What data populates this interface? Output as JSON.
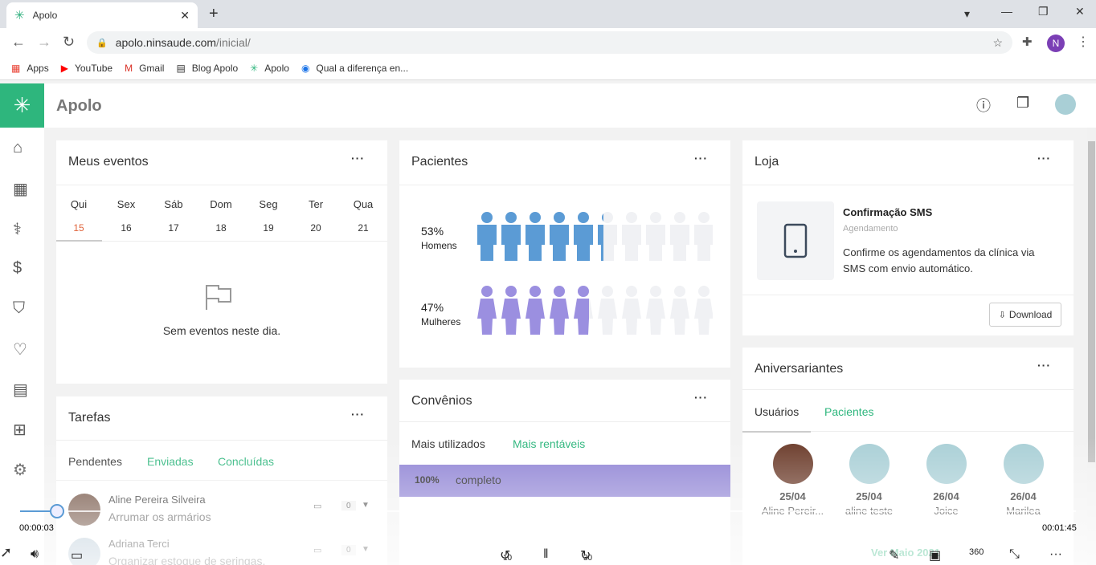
{
  "browser": {
    "tab_title": "Apolo",
    "url_host": "apolo.ninsaude.com",
    "url_path": "/inicial/",
    "profile_initial": "N",
    "bookmarks": [
      {
        "label": "Apps",
        "icon": "apps-grid-icon"
      },
      {
        "label": "YouTube",
        "icon": "youtube-icon"
      },
      {
        "label": "Gmail",
        "icon": "gmail-icon"
      },
      {
        "label": "Blog Apolo",
        "icon": "blog-icon"
      },
      {
        "label": "Apolo",
        "icon": "apolo-icon"
      },
      {
        "label": "Qual a diferença en...",
        "icon": "globe-icon"
      }
    ]
  },
  "app": {
    "title": "Apolo"
  },
  "eventos": {
    "title": "Meus eventos",
    "days": [
      {
        "name": "Qui",
        "num": "15"
      },
      {
        "name": "Sex",
        "num": "16"
      },
      {
        "name": "Sáb",
        "num": "17"
      },
      {
        "name": "Dom",
        "num": "18"
      },
      {
        "name": "Seg",
        "num": "19"
      },
      {
        "name": "Ter",
        "num": "20"
      },
      {
        "name": "Qua",
        "num": "21"
      }
    ],
    "empty_text": "Sem eventos neste dia."
  },
  "tarefas": {
    "title": "Tarefas",
    "tabs": [
      "Pendentes",
      "Enviadas",
      "Concluídas"
    ],
    "items": [
      {
        "name": "Aline Pereira Silveira",
        "task": "Arrumar os armários",
        "comments": "0"
      },
      {
        "name": "Adriana Terci",
        "task": "Organizar estoque de seringas.",
        "comments": "0"
      }
    ]
  },
  "pacientes": {
    "title": "Pacientes",
    "homens_pct": "53%",
    "homens_label": "Homens",
    "homens_value": 0.53,
    "mulheres_pct": "47%",
    "mulheres_label": "Mulheres",
    "mulheres_value": 0.47,
    "male_color": "#5b9bd5",
    "female_color": "#9b8fe0"
  },
  "convenios": {
    "title": "Convênios",
    "tabs": [
      "Mais utilizados",
      "Mais rentáveis"
    ],
    "bar_pct": "100%",
    "bar_label": "completo",
    "bar_color": "#8e82d4"
  },
  "loja": {
    "title": "Loja",
    "product_name": "Confirmação SMS",
    "product_category": "Agendamento",
    "product_desc": "Confirme os agendamentos da clínica via SMS com envio automático.",
    "download_label": "Download"
  },
  "aniversariantes": {
    "title": "Aniversariantes",
    "tabs": [
      "Usuários",
      "Pacientes"
    ],
    "people": [
      {
        "date": "25/04",
        "name": "Aline Pereir..."
      },
      {
        "date": "25/04",
        "name": "aline teste"
      },
      {
        "date": "26/04",
        "name": "Joice"
      },
      {
        "date": "26/04",
        "name": "Marilea"
      }
    ],
    "footer_link": "Ver Maio 2021"
  },
  "video": {
    "time_current": "00:00:03",
    "time_total": "00:01:45",
    "progress": 0.03,
    "rewind_label": "10",
    "forward_label": "30",
    "vr_label": "360"
  },
  "colors": {
    "brand": "#2eb67d"
  }
}
